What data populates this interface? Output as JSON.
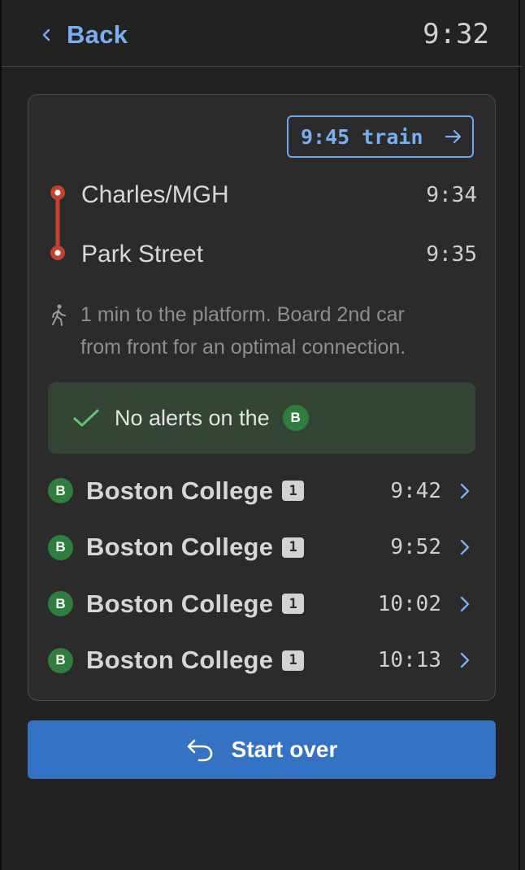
{
  "header": {
    "back_label": "Back",
    "clock": "9:32"
  },
  "card": {
    "train_button": "9:45 train",
    "route": {
      "line_color": "#c4402f",
      "stops": [
        {
          "name": "Charles/MGH",
          "time": "9:34"
        },
        {
          "name": "Park Street",
          "time": "9:35"
        }
      ]
    },
    "walk_note": {
      "icon": "walking-person-icon",
      "lines": [
        "1 min to the platform. Board 2nd car",
        "from front for an optimal connection."
      ]
    },
    "alerts": {
      "text": "No alerts on the",
      "line_badge": "B",
      "icon": "check-icon"
    },
    "trips": [
      {
        "line": "B",
        "destination": "Boston College",
        "car": "1",
        "time": "9:42"
      },
      {
        "line": "B",
        "destination": "Boston College",
        "car": "1",
        "time": "9:52"
      },
      {
        "line": "B",
        "destination": "Boston College",
        "car": "1",
        "time": "10:02"
      },
      {
        "line": "B",
        "destination": "Boston College",
        "car": "1",
        "time": "10:13"
      }
    ]
  },
  "start_over": {
    "label": "Start over",
    "icon": "undo-arrow-icon"
  },
  "colors": {
    "accent_blue": "#79aef2",
    "button_blue": "#3572c4",
    "green_line": "#2f7d3f",
    "red_line": "#c4402f",
    "alert_bg": "#344536"
  }
}
